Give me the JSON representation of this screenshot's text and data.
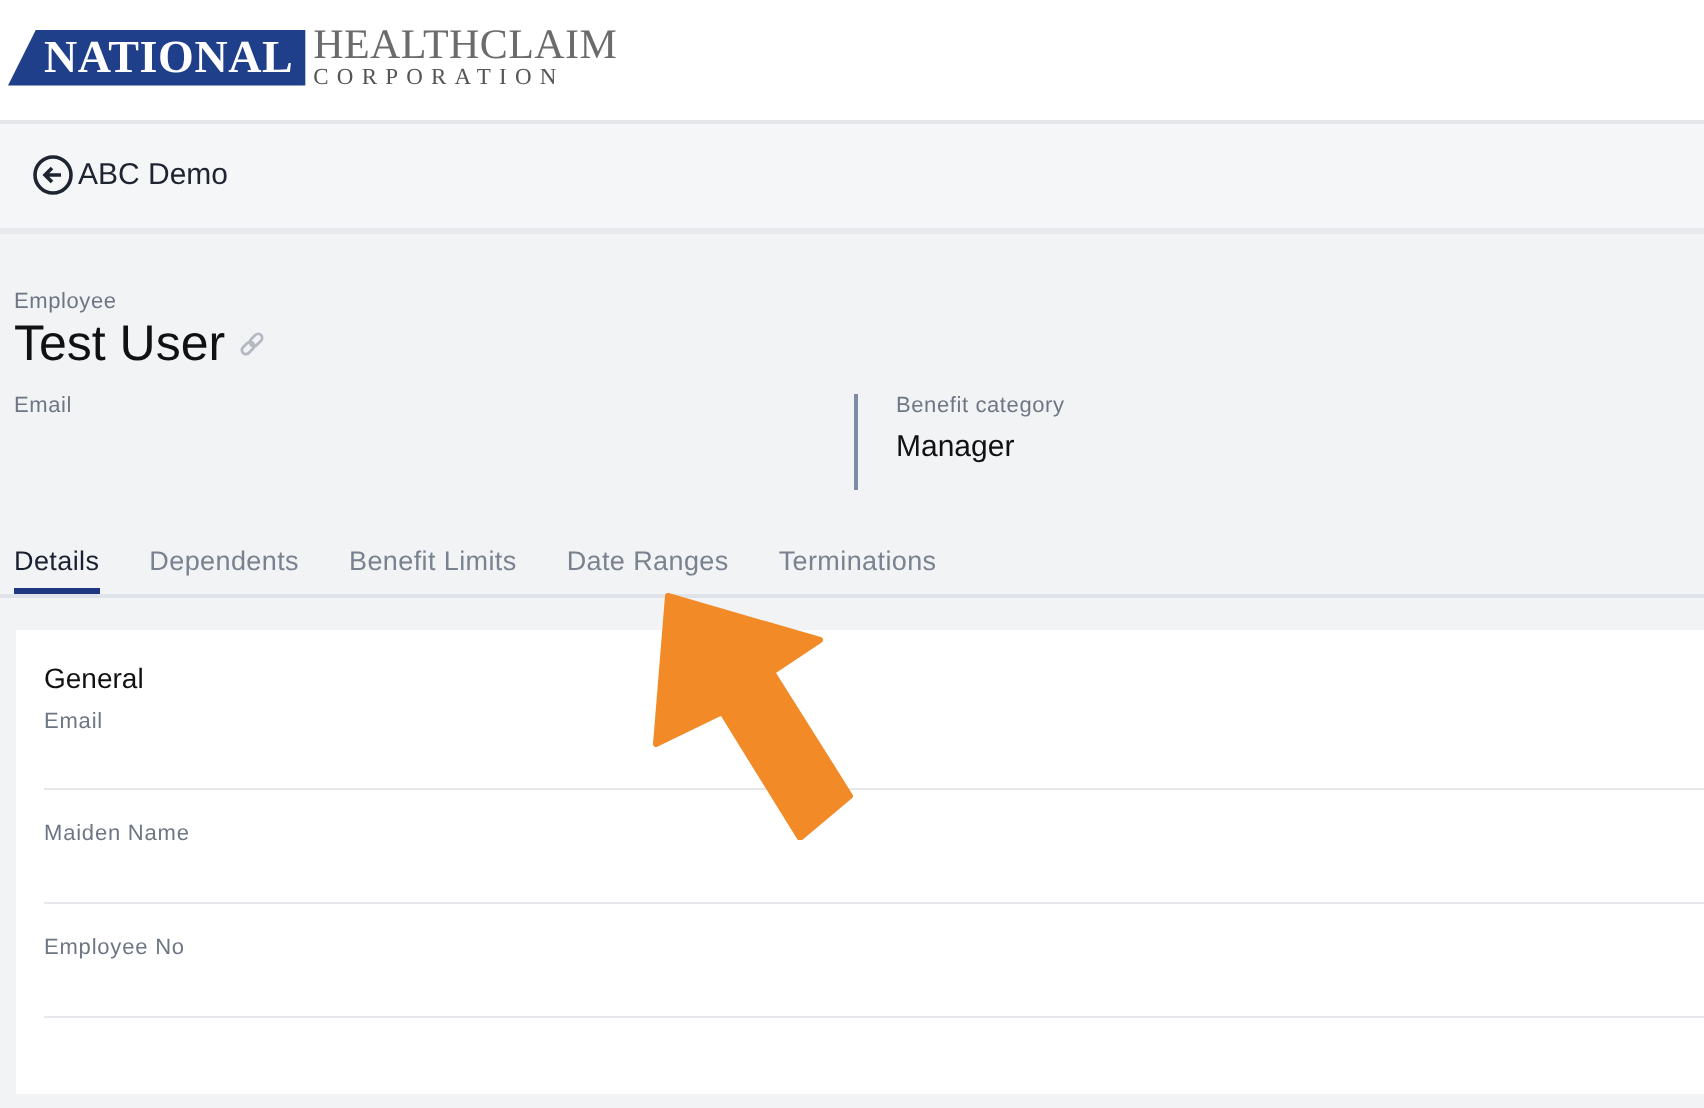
{
  "logo": {
    "badge": "NATIONAL",
    "name": "HEALTHCLAIM",
    "subtitle": "CORPORATION"
  },
  "back_link": {
    "label": "ABC Demo"
  },
  "employee": {
    "caption": "Employee",
    "name": "Test User",
    "email_label": "Email",
    "category_label": "Benefit category",
    "category": "Manager"
  },
  "tabs": [
    {
      "label": "Details",
      "selected": true
    },
    {
      "label": "Dependents",
      "selected": false
    },
    {
      "label": "Benefit Limits",
      "selected": false
    },
    {
      "label": "Date Ranges",
      "selected": false
    },
    {
      "label": "Terminations",
      "selected": false
    }
  ],
  "general": {
    "title": "General",
    "fields": [
      {
        "label": "Email"
      },
      {
        "label": "Maiden Name"
      },
      {
        "label": "Employee No"
      }
    ]
  }
}
